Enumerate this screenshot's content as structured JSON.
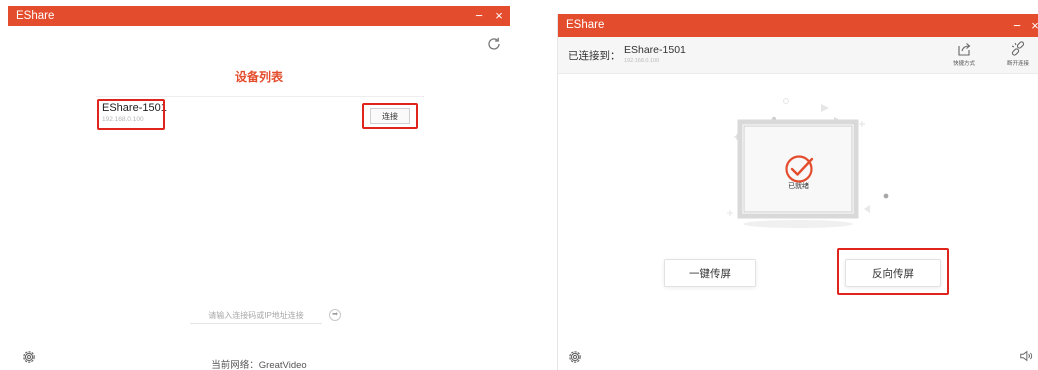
{
  "left_window": {
    "title": "EShare",
    "minimize": "−",
    "close": "×",
    "list_title": "设备列表",
    "devices": [
      {
        "name": "EShare-1501",
        "ip": "192.168.0.100",
        "action": "连接"
      }
    ],
    "input": {
      "placeholder": "请输入连接码或IP地址连接",
      "value": ""
    },
    "go_symbol": "➡",
    "network_label": "当前网络：GreatVideo"
  },
  "right_window": {
    "title": "EShare",
    "minimize": "−",
    "close": "×",
    "connected_prefix": "已连接到：",
    "connected_name": "EShare-1501",
    "connected_ip": "192.168.0.100",
    "tools": [
      {
        "label": "快捷方式",
        "icon": "share-icon"
      },
      {
        "label": "断开连接",
        "icon": "disconnect-icon"
      }
    ],
    "status_label": "已就绪",
    "buttons": {
      "mirror": "一键传屏",
      "reverse": "反向传屏"
    }
  },
  "colors": {
    "accent": "#e34d2d",
    "highlight": "#e0241b"
  }
}
